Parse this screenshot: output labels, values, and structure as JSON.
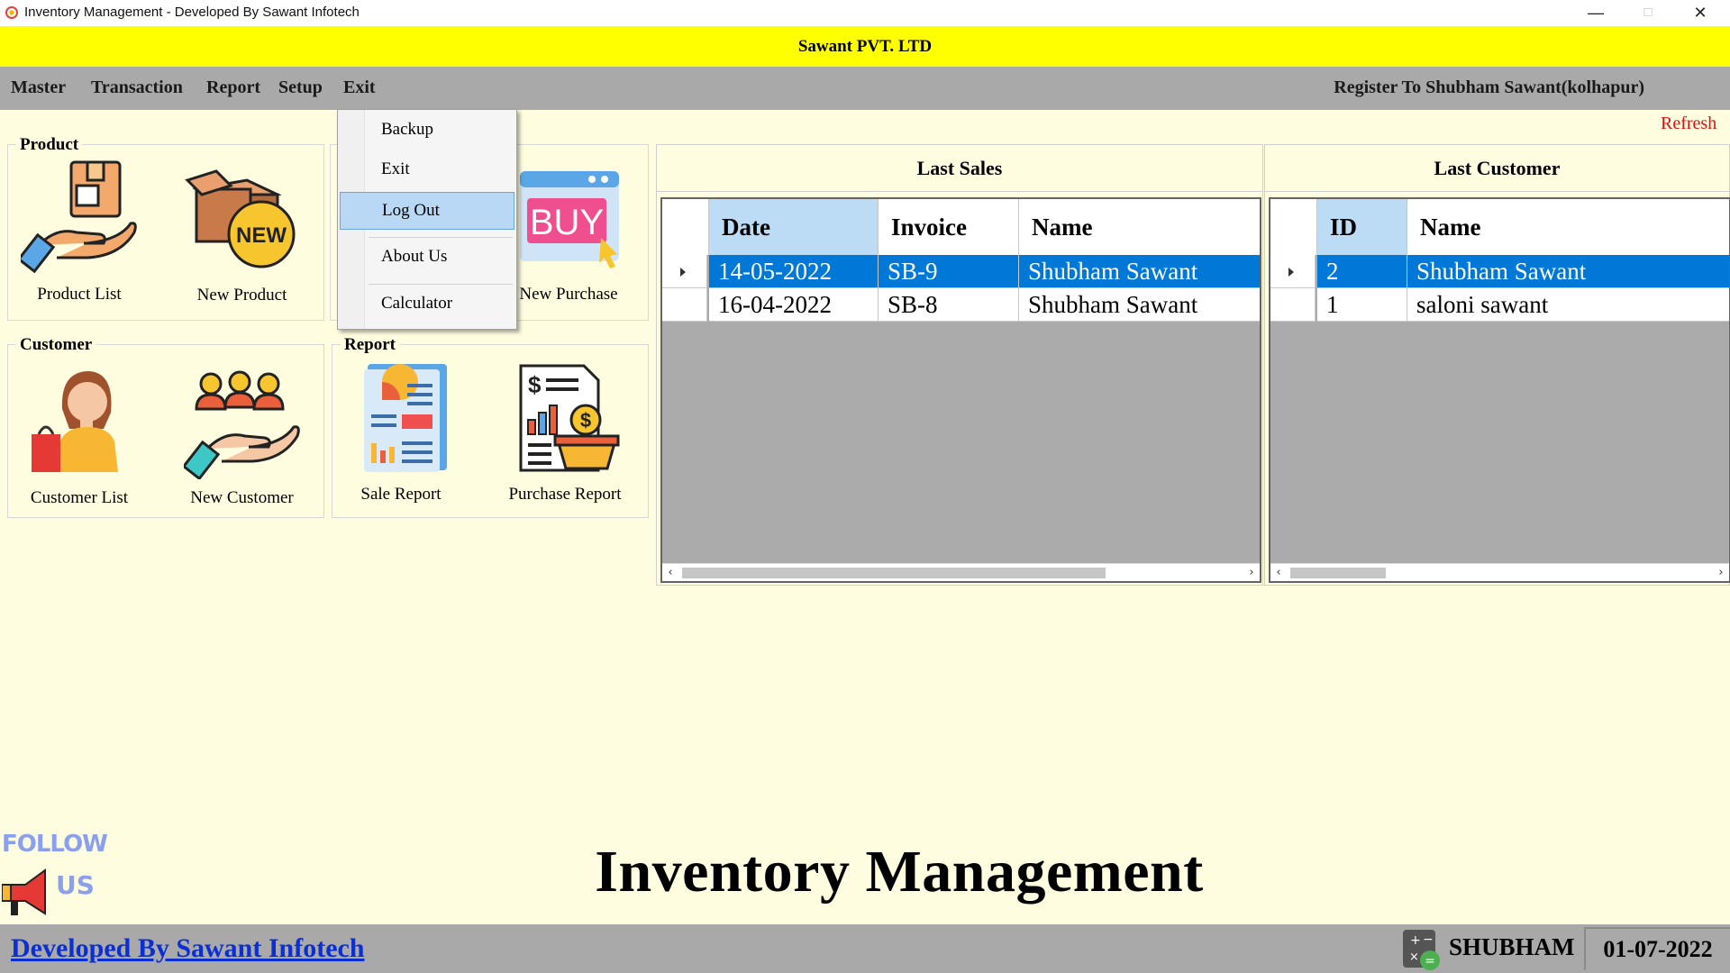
{
  "window": {
    "title": "Inventory Management - Developed By Sawant Infotech",
    "min_icon": "minimize-icon",
    "max_icon": "maximize-icon",
    "close_icon": "close-icon"
  },
  "banner": {
    "company": "Sawant PVT. LTD"
  },
  "menu": {
    "items": [
      "Master",
      "Transaction",
      "Report",
      "Setup",
      "Exit"
    ],
    "register_text": "Register To Shubham Sawant(kolhapur)"
  },
  "dropdown": {
    "items": [
      "Backup",
      "Exit",
      "Log Out",
      "About Us",
      "Calculator"
    ],
    "highlighted": "Log Out"
  },
  "refresh_label": "Refresh",
  "groups": {
    "product": {
      "title": "Product",
      "tiles": [
        "Product List",
        "New Product"
      ]
    },
    "transaction": {
      "tiles": [
        "New Purchase"
      ]
    },
    "customer": {
      "title": "Customer",
      "tiles": [
        "Customer List",
        "New Customer"
      ]
    },
    "report": {
      "title": "Report",
      "tiles": [
        "Sale Report",
        "Purchase Report"
      ]
    }
  },
  "last_sales": {
    "title": "Last Sales",
    "columns": [
      "Date",
      "Invoice",
      "Name"
    ],
    "rows": [
      [
        "14-05-2022",
        "SB-9",
        "Shubham Sawant"
      ],
      [
        "16-04-2022",
        "SB-8",
        "Shubham Sawant"
      ]
    ]
  },
  "last_customer": {
    "title": "Last Customer",
    "columns": [
      "ID",
      "Name"
    ],
    "rows": [
      [
        "2",
        "Shubham Sawant"
      ],
      [
        "1",
        "saloni sawant"
      ]
    ]
  },
  "follow": {
    "line1": "FOLLOW",
    "line2": "US"
  },
  "app_title": "Inventory Management",
  "status": {
    "developer_link": "Developed By Sawant Infotech",
    "user": "SHUBHAM",
    "date": "01-07-2022"
  },
  "colors": {
    "background": "#fffde0",
    "banner": "#ffff00",
    "menubar": "#a9a9a9",
    "selection": "#0078d7",
    "refresh": "#e01010",
    "link": "#0a2fd4"
  }
}
